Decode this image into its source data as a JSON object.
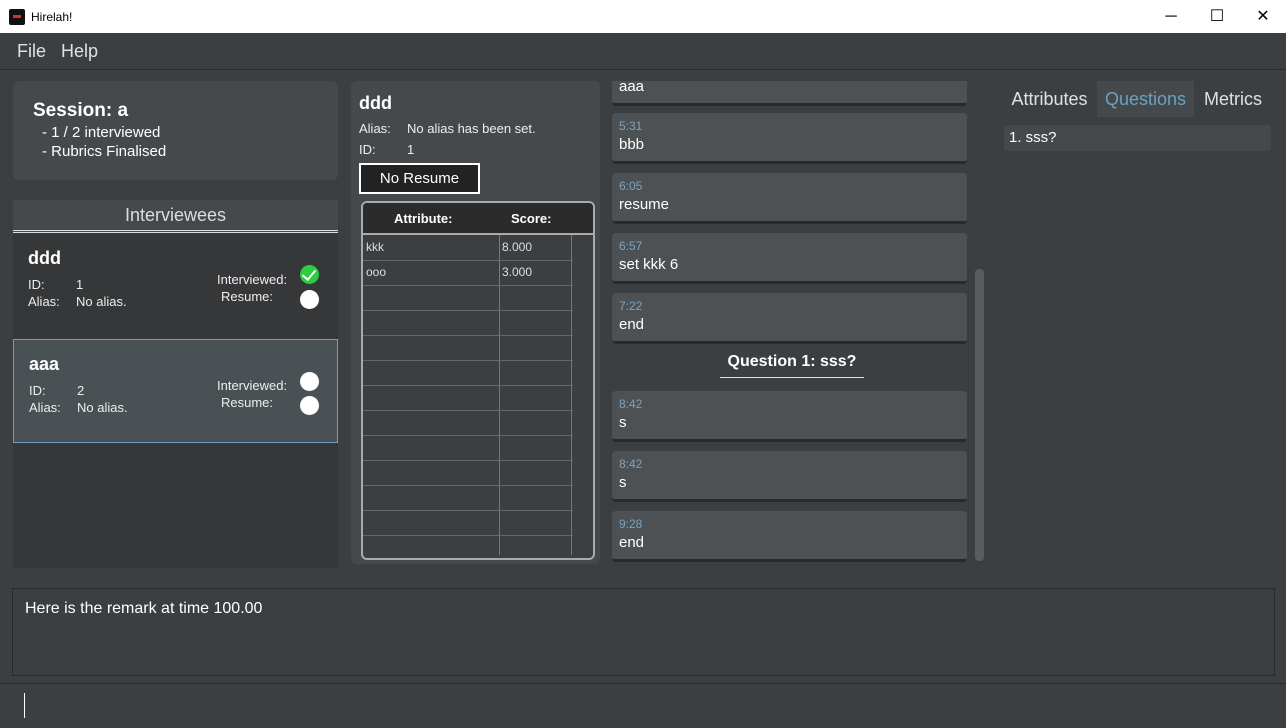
{
  "window": {
    "title": "Hirelah!",
    "minimize_glyph": "─",
    "maximize_glyph": "☐",
    "close_glyph": "✕"
  },
  "menu": {
    "file": "File",
    "help": "Help"
  },
  "session": {
    "title": "Session: a",
    "line1": "- 1 / 2 interviewed",
    "line2": "- Rubrics Finalised"
  },
  "interviewees": {
    "header": "Interviewees",
    "items": [
      {
        "name": "ddd",
        "id_label": "ID:",
        "id": "1",
        "alias_label": "Alias:",
        "alias": "No alias.",
        "interviewed_label": "Interviewed:",
        "resume_label": "Resume:",
        "interviewed": true,
        "resume": false
      },
      {
        "name": "aaa",
        "id_label": "ID:",
        "id": "2",
        "alias_label": "Alias:",
        "alias": "No alias.",
        "interviewed_label": "Interviewed:",
        "resume_label": "Resume:",
        "interviewed": false,
        "resume": false
      }
    ]
  },
  "detail": {
    "name": "ddd",
    "alias_label": "Alias:",
    "alias": "No alias has been set.",
    "id_label": "ID:",
    "id": "1",
    "resume_button": "No Resume",
    "table": {
      "headers": [
        "Attribute:",
        "Score:"
      ],
      "rows": [
        [
          "kkk",
          "8.000"
        ],
        [
          "ooo",
          "3.000"
        ]
      ]
    }
  },
  "transcript": {
    "remarks_before": [
      {
        "time": "",
        "text": "aaa"
      },
      {
        "time": "5:31",
        "text": "bbb"
      },
      {
        "time": "6:05",
        "text": "resume"
      },
      {
        "time": "6:57",
        "text": "set kkk 6"
      },
      {
        "time": "7:22",
        "text": "end"
      }
    ],
    "question_heading": "Question 1: sss?",
    "remarks_after": [
      {
        "time": "8:42",
        "text": "s"
      },
      {
        "time": "8:42",
        "text": "s"
      },
      {
        "time": "9:28",
        "text": "end"
      }
    ]
  },
  "tabs": {
    "attributes": "Attributes",
    "questions": "Questions",
    "metrics": "Metrics",
    "active": "Questions"
  },
  "questions": [
    "1. sss?"
  ],
  "remark_display": "Here is the remark at time 100.00",
  "command_input": {
    "value": ""
  },
  "colors": {
    "accent": "#6ba0c2",
    "check": "#2ecc40",
    "background": "#3c3f41"
  }
}
